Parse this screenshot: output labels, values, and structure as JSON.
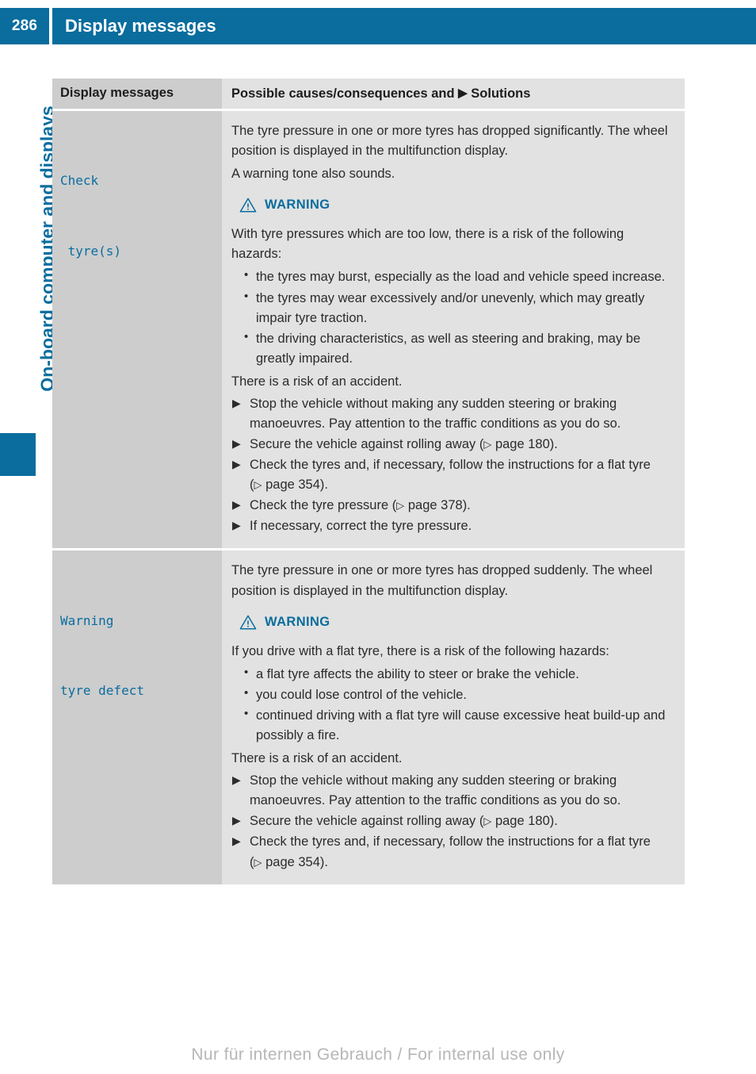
{
  "header": {
    "page_number": "286",
    "title": "Display messages",
    "bar_color": "#0a6d9e"
  },
  "side_tab": {
    "label": "On-board computer and displays",
    "color": "#0a6d9e"
  },
  "table": {
    "columns": {
      "left_header": "Display messages",
      "right_header_prefix": "Possible causes/consequences and",
      "right_header_marker": "▶",
      "right_header_suffix": "Solutions"
    },
    "rows": [
      {
        "message_line_1": "Check",
        "message_line_2": " tyre(s)",
        "intro": [
          "The tyre pressure in one or more tyres has dropped significantly. The wheel position is displayed in the multifunction display.",
          "A warning tone also sounds."
        ],
        "warning_label": "WARNING",
        "warning_intro": "With tyre pressures which are too low, there is a risk of the following hazards:",
        "hazards": [
          "the tyres may burst, especially as the load and vehicle speed increase.",
          "the tyres may wear excessively and/or unevenly, which may greatly impair tyre traction.",
          "the driving characteristics, as well as steering and braking, may be greatly impaired."
        ],
        "risk_line": "There is a risk of an accident.",
        "steps": [
          {
            "text": "Stop the vehicle without making any sudden steering or braking manoeuvres. Pay attention to the traffic conditions as you do so.",
            "ref": ""
          },
          {
            "text": "Secure the vehicle against rolling away",
            "ref": "page 180"
          },
          {
            "text": "Check the tyres and, if necessary, follow the instructions for a flat tyre",
            "ref": "page 354"
          },
          {
            "text": "Check the tyre pressure",
            "ref": "page 378"
          },
          {
            "text": "If necessary, correct the tyre pressure.",
            "ref": ""
          }
        ]
      },
      {
        "message_line_1": "Warning",
        "message_line_2": "tyre defect",
        "intro": [
          "The tyre pressure in one or more tyres has dropped suddenly. The wheel position is displayed in the multifunction display."
        ],
        "warning_label": "WARNING",
        "warning_intro": "If you drive with a flat tyre, there is a risk of the following hazards:",
        "hazards": [
          "a flat tyre affects the ability to steer or brake the vehicle.",
          "you could lose control of the vehicle.",
          "continued driving with a flat tyre will cause excessive heat build-up and possibly a fire."
        ],
        "risk_line": "There is a risk of an accident.",
        "steps": [
          {
            "text": "Stop the vehicle without making any sudden steering or braking manoeuvres. Pay attention to the traffic conditions as you do so.",
            "ref": ""
          },
          {
            "text": "Secure the vehicle against rolling away",
            "ref": "page 180"
          },
          {
            "text": "Check the tyres and, if necessary, follow the instructions for a flat tyre",
            "ref": "page 354"
          }
        ]
      }
    ]
  },
  "footer": {
    "watermark": "Nur für internen Gebrauch / For internal use only"
  },
  "glyphs": {
    "solid_triangle": "▶",
    "hollow_triangle": "▷"
  }
}
